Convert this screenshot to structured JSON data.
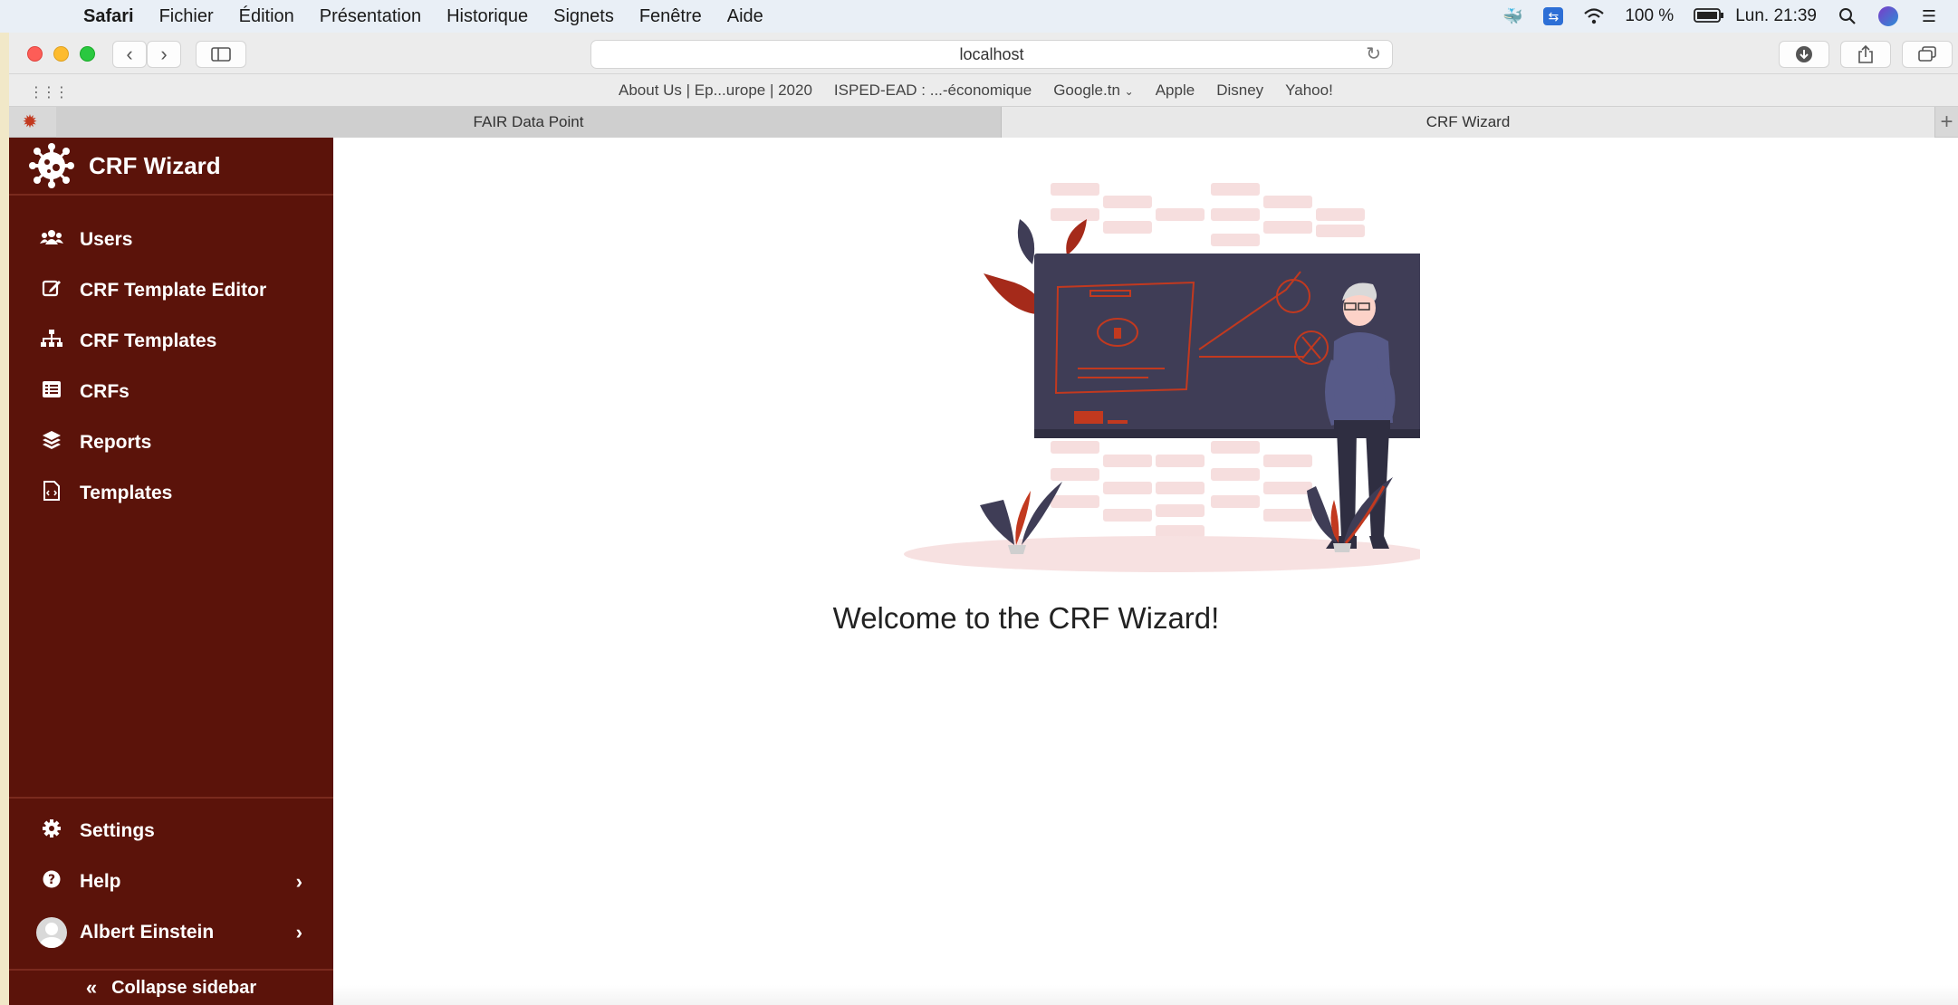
{
  "menubar": {
    "items": [
      "Safari",
      "Fichier",
      "Édition",
      "Présentation",
      "Historique",
      "Signets",
      "Fenêtre",
      "Aide"
    ],
    "battery": "100 %",
    "clock": "Lun. 21:39"
  },
  "toolbar": {
    "address": "localhost"
  },
  "bookmarks": {
    "items": [
      "About Us | Ep...urope | 2020",
      "ISPED-EAD : ...-économique",
      "Google.tn",
      "Apple",
      "Disney",
      "Yahoo!"
    ]
  },
  "tabs": {
    "inactive": "FAIR Data Point",
    "active": "CRF Wizard"
  },
  "sidebar": {
    "brand": "CRF Wizard",
    "items": [
      {
        "label": "Users",
        "icon": "users-icon"
      },
      {
        "label": "CRF Template Editor",
        "icon": "edit-icon"
      },
      {
        "label": "CRF Templates",
        "icon": "sitemap-icon"
      },
      {
        "label": "CRFs",
        "icon": "list-icon"
      },
      {
        "label": "Reports",
        "icon": "layers-icon"
      },
      {
        "label": "Templates",
        "icon": "file-code-icon"
      }
    ],
    "settings": "Settings",
    "help": "Help",
    "user": "Albert Einstein",
    "collapse": "Collapse sidebar"
  },
  "main": {
    "welcome": "Welcome to the CRF Wizard!"
  },
  "colors": {
    "sidebar_bg": "#5b130a",
    "accent_red": "#c2391f",
    "board": "#3f3d56"
  }
}
